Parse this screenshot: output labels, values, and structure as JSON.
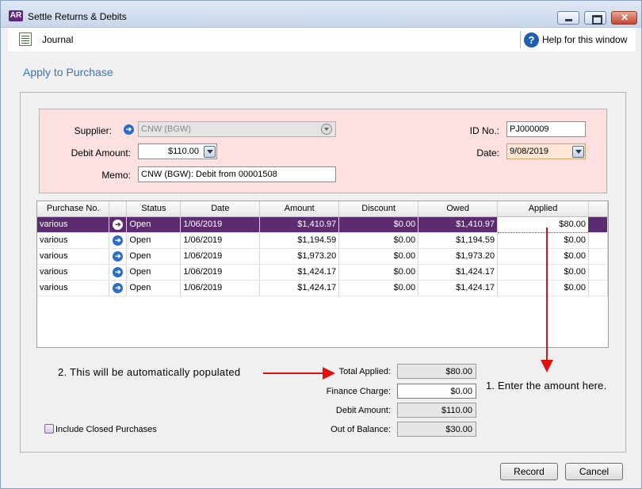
{
  "window": {
    "app_badge": "AR",
    "title": "Settle Returns & Debits"
  },
  "toolbar": {
    "journal_label": "Journal",
    "help_label": "Help for this window"
  },
  "heading": "Apply to Purchase",
  "form": {
    "supplier_label": "Supplier:",
    "supplier_value": "CNW (BGW)",
    "debit_amount_label": "Debit Amount:",
    "debit_amount_value": "$110.00",
    "memo_label": "Memo:",
    "memo_value": "CNW (BGW): Debit from 00001508",
    "id_label": "ID No.:",
    "id_value": "PJ000009",
    "date_label": "Date:",
    "date_value": "9/08/2019"
  },
  "grid": {
    "columns": [
      "Purchase No.",
      "",
      "Status",
      "Date",
      "Amount",
      "Discount",
      "Owed",
      "Applied"
    ],
    "rows": [
      {
        "purchase_no": "various",
        "status": "Open",
        "date": "1/06/2019",
        "amount": "$1,410.97",
        "discount": "$0.00",
        "owed": "$1,410.97",
        "applied": "$80.00"
      },
      {
        "purchase_no": "various",
        "status": "Open",
        "date": "1/06/2019",
        "amount": "$1,194.59",
        "discount": "$0.00",
        "owed": "$1,194.59",
        "applied": "$0.00"
      },
      {
        "purchase_no": "various",
        "status": "Open",
        "date": "1/06/2019",
        "amount": "$1,973.20",
        "discount": "$0.00",
        "owed": "$1,973.20",
        "applied": "$0.00"
      },
      {
        "purchase_no": "various",
        "status": "Open",
        "date": "1/06/2019",
        "amount": "$1,424.17",
        "discount": "$0.00",
        "owed": "$1,424.17",
        "applied": "$0.00"
      },
      {
        "purchase_no": "various",
        "status": "Open",
        "date": "1/06/2019",
        "amount": "$1,424.17",
        "discount": "$0.00",
        "owed": "$1,424.17",
        "applied": "$0.00"
      }
    ]
  },
  "annotations": {
    "note_2": "2. This will be automatically populated",
    "note_1": "1. Enter the amount here.",
    "arrow_color": "#e01010"
  },
  "summary": {
    "total_applied_label": "Total Applied:",
    "total_applied_value": "$80.00",
    "finance_charge_label": "Finance Charge:",
    "finance_charge_value": "$0.00",
    "debit_amount_label": "Debit Amount:",
    "debit_amount_value": "$110.00",
    "out_of_balance_label": "Out of Balance:",
    "out_of_balance_value": "$30.00"
  },
  "include_closed_label": "Include Closed Purchases",
  "buttons": {
    "record": "Record",
    "cancel": "Cancel"
  },
  "colors": {
    "selected_row": "#5b2c6f",
    "form_background": "#fde0e0",
    "heading": "#3a76b5"
  }
}
